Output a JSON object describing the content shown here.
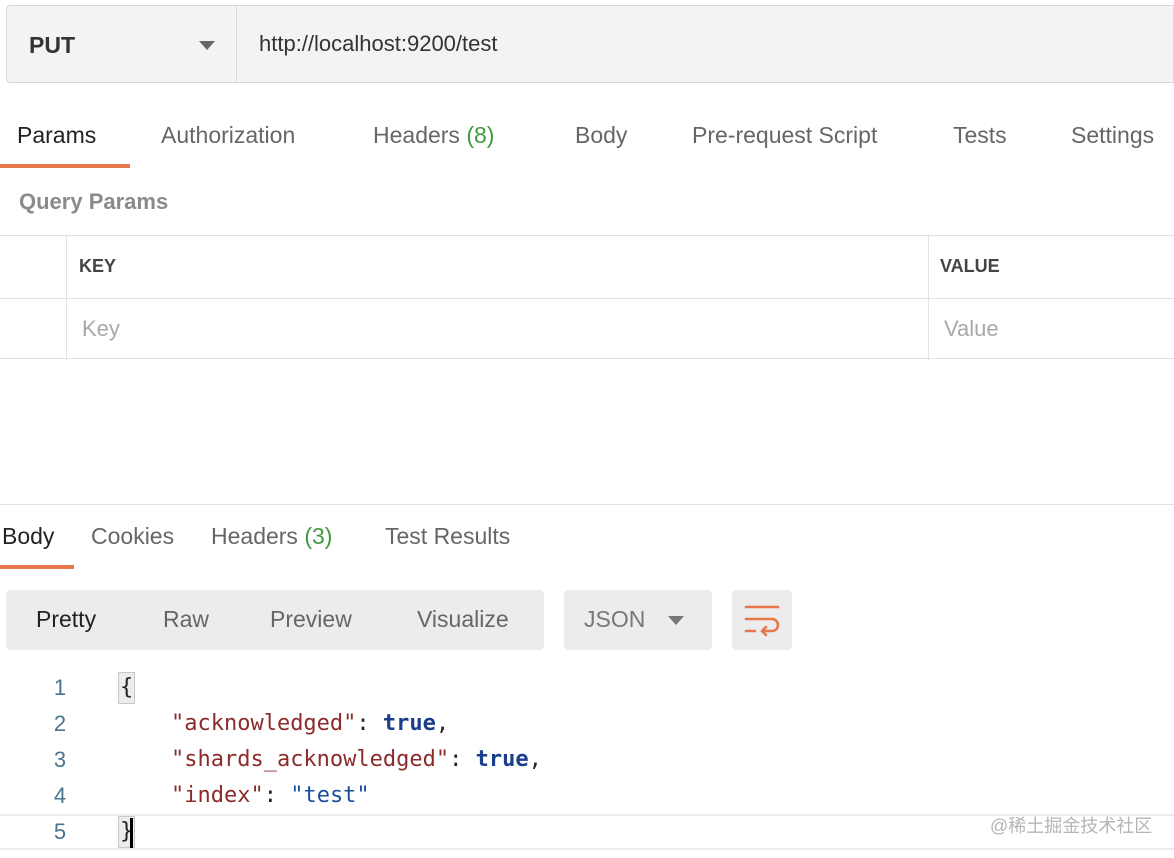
{
  "request": {
    "method": "PUT",
    "url": "http://localhost:9200/test"
  },
  "request_tabs": [
    {
      "label": "Params",
      "active": true
    },
    {
      "label": "Authorization"
    },
    {
      "label": "Headers",
      "count": "(8)"
    },
    {
      "label": "Body"
    },
    {
      "label": "Pre-request Script"
    },
    {
      "label": "Tests"
    },
    {
      "label": "Settings"
    }
  ],
  "query_params": {
    "title": "Query Params",
    "headers": {
      "key": "KEY",
      "value": "VALUE"
    },
    "placeholders": {
      "key": "Key",
      "value": "Value"
    }
  },
  "response_tabs": [
    {
      "label": "Body",
      "active": true
    },
    {
      "label": "Cookies"
    },
    {
      "label": "Headers",
      "count": "(3)"
    },
    {
      "label": "Test Results"
    }
  ],
  "view_modes": [
    "Pretty",
    "Raw",
    "Preview",
    "Visualize"
  ],
  "active_view_mode": "Pretty",
  "format": "JSON",
  "code_lines": [
    {
      "num": "1",
      "open": "{"
    },
    {
      "num": "2",
      "key": "\"acknowledged\"",
      "sep": ": ",
      "value": "true",
      "end": ","
    },
    {
      "num": "3",
      "key": "\"shards_acknowledged\"",
      "sep": ": ",
      "value": "true",
      "end": ","
    },
    {
      "num": "4",
      "key": "\"index\"",
      "sep": ": ",
      "value": "\"test\"",
      "end": ""
    },
    {
      "num": "5",
      "close": "}"
    }
  ],
  "watermark": "@稀土掘金技术社区",
  "colors": {
    "accent": "#e8784b",
    "count_green": "#3f9a3f"
  }
}
